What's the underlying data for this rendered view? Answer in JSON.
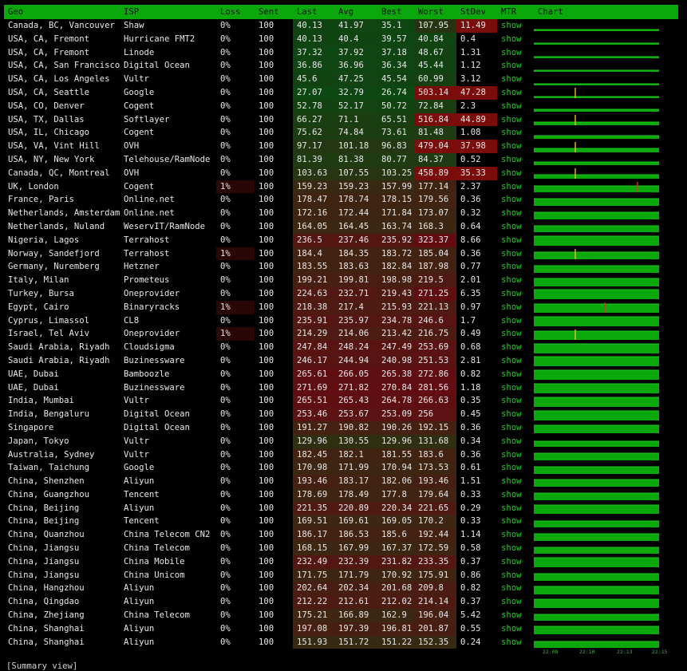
{
  "headers": [
    "Geo",
    "ISP",
    "Loss",
    "Sent",
    "Last",
    "Avg",
    "Best",
    "Worst",
    "StDev",
    "MTR",
    "Chart"
  ],
  "mtr_label": "show",
  "rows": [
    {
      "geo": "Canada, BC, Vancouver",
      "isp": "Shaw",
      "loss": "0%",
      "sent": "100",
      "last": "40.13",
      "avg": "41.97",
      "best": "35.1",
      "worst": "107.95",
      "stdev": "11.49",
      "spike": 0
    },
    {
      "geo": "USA, CA, Fremont",
      "isp": "Hurricane FMT2",
      "loss": "0%",
      "sent": "100",
      "last": "40.13",
      "avg": "40.4",
      "best": "39.57",
      "worst": "40.84",
      "stdev": "0.4",
      "spike": 0
    },
    {
      "geo": "USA, CA, Fremont",
      "isp": "Linode",
      "loss": "0%",
      "sent": "100",
      "last": "37.32",
      "avg": "37.92",
      "best": "37.18",
      "worst": "48.67",
      "stdev": "1.31",
      "spike": 0
    },
    {
      "geo": "USA, CA, San Francisco",
      "isp": "Digital Ocean",
      "loss": "0%",
      "sent": "100",
      "last": "36.86",
      "avg": "36.96",
      "best": "36.34",
      "worst": "45.44",
      "stdev": "1.12",
      "spike": 0
    },
    {
      "geo": "USA, CA, Los Angeles",
      "isp": "Vultr",
      "loss": "0%",
      "sent": "100",
      "last": "45.6",
      "avg": "47.25",
      "best": "45.54",
      "worst": "60.99",
      "stdev": "3.12",
      "spike": 0
    },
    {
      "geo": "USA, CA, Seattle",
      "isp": "Google",
      "loss": "0%",
      "sent": "100",
      "last": "27.07",
      "avg": "32.79",
      "best": "26.74",
      "worst": "503.14",
      "stdev": "47.28",
      "spike": 0.33
    },
    {
      "geo": "USA, CO, Denver",
      "isp": "Cogent",
      "loss": "0%",
      "sent": "100",
      "last": "52.78",
      "avg": "52.17",
      "best": "50.72",
      "worst": "72.84",
      "stdev": "2.3",
      "spike": 0
    },
    {
      "geo": "USA, TX, Dallas",
      "isp": "Softlayer",
      "loss": "0%",
      "sent": "100",
      "last": "66.27",
      "avg": "71.1",
      "best": "65.51",
      "worst": "516.84",
      "stdev": "44.89",
      "spike": 0.33
    },
    {
      "geo": "USA, IL, Chicago",
      "isp": "Cogent",
      "loss": "0%",
      "sent": "100",
      "last": "75.62",
      "avg": "74.84",
      "best": "73.61",
      "worst": "81.48",
      "stdev": "1.08",
      "spike": 0
    },
    {
      "geo": "USA, VA, Vint Hill",
      "isp": "OVH",
      "loss": "0%",
      "sent": "100",
      "last": "97.17",
      "avg": "101.18",
      "best": "96.83",
      "worst": "479.04",
      "stdev": "37.98",
      "spike": 0.33
    },
    {
      "geo": "USA, NY, New York",
      "isp": "Telehouse/RamNode",
      "loss": "0%",
      "sent": "100",
      "last": "81.39",
      "avg": "81.38",
      "best": "80.77",
      "worst": "84.37",
      "stdev": "0.52",
      "spike": 0
    },
    {
      "geo": "Canada, QC, Montreal",
      "isp": "OVH",
      "loss": "0%",
      "sent": "100",
      "last": "103.63",
      "avg": "107.55",
      "best": "103.25",
      "worst": "458.89",
      "stdev": "35.33",
      "spike": 0.33
    },
    {
      "geo": "UK, London",
      "isp": "Cogent",
      "loss": "1%",
      "sent": "100",
      "last": "159.23",
      "avg": "159.23",
      "best": "157.99",
      "worst": "177.14",
      "stdev": "2.37",
      "spike": 0.83
    },
    {
      "geo": "France, Paris",
      "isp": "Online.net",
      "loss": "0%",
      "sent": "100",
      "last": "178.47",
      "avg": "178.74",
      "best": "178.15",
      "worst": "179.56",
      "stdev": "0.36",
      "spike": 0
    },
    {
      "geo": "Netherlands, Amsterdam",
      "isp": "Online.net",
      "loss": "0%",
      "sent": "100",
      "last": "172.16",
      "avg": "172.44",
      "best": "171.84",
      "worst": "173.07",
      "stdev": "0.32",
      "spike": 0
    },
    {
      "geo": "Netherlands, Nuland",
      "isp": "WeservIT/RamNode",
      "loss": "0%",
      "sent": "100",
      "last": "164.05",
      "avg": "164.45",
      "best": "163.74",
      "worst": "168.3",
      "stdev": "0.64",
      "spike": 0
    },
    {
      "geo": "Nigeria, Lagos",
      "isp": "Terrahost",
      "loss": "0%",
      "sent": "100",
      "last": "236.5",
      "avg": "237.46",
      "best": "235.92",
      "worst": "323.37",
      "stdev": "8.66",
      "spike": 0
    },
    {
      "geo": "Norway, Sandefjord",
      "isp": "Terrahost",
      "loss": "1%",
      "sent": "100",
      "last": "184.4",
      "avg": "184.35",
      "best": "183.72",
      "worst": "185.04",
      "stdev": "0.36",
      "spike": 0.33
    },
    {
      "geo": "Germany, Nuremberg",
      "isp": "Hetzner",
      "loss": "0%",
      "sent": "100",
      "last": "183.55",
      "avg": "183.63",
      "best": "182.84",
      "worst": "187.98",
      "stdev": "0.77",
      "spike": 0
    },
    {
      "geo": "Italy, Milan",
      "isp": "Prometeus",
      "loss": "0%",
      "sent": "100",
      "last": "199.21",
      "avg": "199.81",
      "best": "198.98",
      "worst": "219.5",
      "stdev": "2.01",
      "spike": 0
    },
    {
      "geo": "Turkey, Bursa",
      "isp": "Oneprovider",
      "loss": "0%",
      "sent": "100",
      "last": "224.63",
      "avg": "232.71",
      "best": "219.43",
      "worst": "271.25",
      "stdev": "6.35",
      "spike": 0
    },
    {
      "geo": "Egypt, Cairo",
      "isp": "Binaryracks",
      "loss": "1%",
      "sent": "100",
      "last": "218.38",
      "avg": "217.4",
      "best": "215.93",
      "worst": "221.13",
      "stdev": "0.97",
      "spike": 0.57
    },
    {
      "geo": "Cyprus, Limassol",
      "isp": "CL8",
      "loss": "0%",
      "sent": "100",
      "last": "235.91",
      "avg": "235.97",
      "best": "234.78",
      "worst": "246.6",
      "stdev": "1.7",
      "spike": 0
    },
    {
      "geo": "Israel, Tel Aviv",
      "isp": "Oneprovider",
      "loss": "1%",
      "sent": "100",
      "last": "214.29",
      "avg": "214.06",
      "best": "213.42",
      "worst": "216.75",
      "stdev": "0.49",
      "spike": 0.33
    },
    {
      "geo": "Saudi Arabia, Riyadh",
      "isp": "Cloudsigma",
      "loss": "0%",
      "sent": "100",
      "last": "247.84",
      "avg": "248.24",
      "best": "247.49",
      "worst": "253.69",
      "stdev": "0.68",
      "spike": 0
    },
    {
      "geo": "Saudi Arabia, Riyadh",
      "isp": "Buzinessware",
      "loss": "0%",
      "sent": "100",
      "last": "246.17",
      "avg": "244.94",
      "best": "240.98",
      "worst": "251.53",
      "stdev": "2.81",
      "spike": 0
    },
    {
      "geo": "UAE, Dubai",
      "isp": "Bamboozle",
      "loss": "0%",
      "sent": "100",
      "last": "265.61",
      "avg": "266.05",
      "best": "265.38",
      "worst": "272.86",
      "stdev": "0.82",
      "spike": 0
    },
    {
      "geo": "UAE, Dubai",
      "isp": "Buzinessware",
      "loss": "0%",
      "sent": "100",
      "last": "271.69",
      "avg": "271.82",
      "best": "270.84",
      "worst": "281.56",
      "stdev": "1.18",
      "spike": 0
    },
    {
      "geo": "India, Mumbai",
      "isp": "Vultr",
      "loss": "0%",
      "sent": "100",
      "last": "265.51",
      "avg": "265.43",
      "best": "264.78",
      "worst": "266.63",
      "stdev": "0.35",
      "spike": 0
    },
    {
      "geo": "India, Bengaluru",
      "isp": "Digital Ocean",
      "loss": "0%",
      "sent": "100",
      "last": "253.46",
      "avg": "253.67",
      "best": "253.09",
      "worst": "256",
      "stdev": "0.45",
      "spike": 0
    },
    {
      "geo": "Singapore",
      "isp": "Digital Ocean",
      "loss": "0%",
      "sent": "100",
      "last": "191.27",
      "avg": "190.82",
      "best": "190.26",
      "worst": "192.15",
      "stdev": "0.36",
      "spike": 0
    },
    {
      "geo": "Japan, Tokyo",
      "isp": "Vultr",
      "loss": "0%",
      "sent": "100",
      "last": "129.96",
      "avg": "130.55",
      "best": "129.96",
      "worst": "131.68",
      "stdev": "0.34",
      "spike": 0
    },
    {
      "geo": "Australia, Sydney",
      "isp": "Vultr",
      "loss": "0%",
      "sent": "100",
      "last": "182.45",
      "avg": "182.1",
      "best": "181.55",
      "worst": "183.6",
      "stdev": "0.36",
      "spike": 0
    },
    {
      "geo": "Taiwan, Taichung",
      "isp": "Google",
      "loss": "0%",
      "sent": "100",
      "last": "170.98",
      "avg": "171.99",
      "best": "170.94",
      "worst": "173.53",
      "stdev": "0.61",
      "spike": 0
    },
    {
      "geo": "China, Shenzhen",
      "isp": "Aliyun",
      "loss": "0%",
      "sent": "100",
      "last": "193.46",
      "avg": "183.17",
      "best": "182.06",
      "worst": "193.46",
      "stdev": "1.51",
      "spike": 0
    },
    {
      "geo": "China, Guangzhou",
      "isp": "Tencent",
      "loss": "0%",
      "sent": "100",
      "last": "178.69",
      "avg": "178.49",
      "best": "177.8",
      "worst": "179.64",
      "stdev": "0.33",
      "spike": 0
    },
    {
      "geo": "China, Beijing",
      "isp": "Aliyun",
      "loss": "0%",
      "sent": "100",
      "last": "221.35",
      "avg": "220.89",
      "best": "220.34",
      "worst": "221.65",
      "stdev": "0.29",
      "spike": 0
    },
    {
      "geo": "China, Beijing",
      "isp": "Tencent",
      "loss": "0%",
      "sent": "100",
      "last": "169.51",
      "avg": "169.61",
      "best": "169.05",
      "worst": "170.2",
      "stdev": "0.33",
      "spike": 0
    },
    {
      "geo": "China, Quanzhou",
      "isp": "China Telecom CN2",
      "loss": "0%",
      "sent": "100",
      "last": "186.17",
      "avg": "186.53",
      "best": "185.6",
      "worst": "192.44",
      "stdev": "1.14",
      "spike": 0
    },
    {
      "geo": "China, Jiangsu",
      "isp": "China Telecom",
      "loss": "0%",
      "sent": "100",
      "last": "168.15",
      "avg": "167.99",
      "best": "167.37",
      "worst": "172.59",
      "stdev": "0.58",
      "spike": 0
    },
    {
      "geo": "China, Jiangsu",
      "isp": "China Mobile",
      "loss": "0%",
      "sent": "100",
      "last": "232.49",
      "avg": "232.39",
      "best": "231.82",
      "worst": "233.35",
      "stdev": "0.37",
      "spike": 0
    },
    {
      "geo": "China, Jiangsu",
      "isp": "China Unicom",
      "loss": "0%",
      "sent": "100",
      "last": "171.75",
      "avg": "171.79",
      "best": "170.92",
      "worst": "175.91",
      "stdev": "0.86",
      "spike": 0
    },
    {
      "geo": "China, Hangzhou",
      "isp": "Aliyun",
      "loss": "0%",
      "sent": "100",
      "last": "202.64",
      "avg": "202.34",
      "best": "201.68",
      "worst": "209.8",
      "stdev": "0.82",
      "spike": 0
    },
    {
      "geo": "China, Qingdao",
      "isp": "Aliyun",
      "loss": "0%",
      "sent": "100",
      "last": "212.22",
      "avg": "212.61",
      "best": "212.02",
      "worst": "214.14",
      "stdev": "0.37",
      "spike": 0
    },
    {
      "geo": "China, Zhejiang",
      "isp": "China Telecom",
      "loss": "0%",
      "sent": "100",
      "last": "175.21",
      "avg": "166.89",
      "best": "162.9",
      "worst": "196.04",
      "stdev": "5.42",
      "spike": 0
    },
    {
      "geo": "China, Shanghai",
      "isp": "Aliyun",
      "loss": "0%",
      "sent": "100",
      "last": "197.08",
      "avg": "197.39",
      "best": "196.81",
      "worst": "201.87",
      "stdev": "0.55",
      "spike": 0
    },
    {
      "geo": "China, Shanghai",
      "isp": "Aliyun",
      "loss": "0%",
      "sent": "100",
      "last": "151.93",
      "avg": "151.72",
      "best": "151.22",
      "worst": "152.35",
      "stdev": "0.24",
      "spike": 0
    }
  ],
  "chart_axis_ticks": [
    "22:08",
    "22:10",
    "22:13",
    "22:15"
  ],
  "bottom_text": "[Summary view]",
  "colors": {
    "header_bg": "#0aa80a",
    "link": "#22cc22",
    "chart_fill": "#0aa80a",
    "spike": "#e03030"
  }
}
